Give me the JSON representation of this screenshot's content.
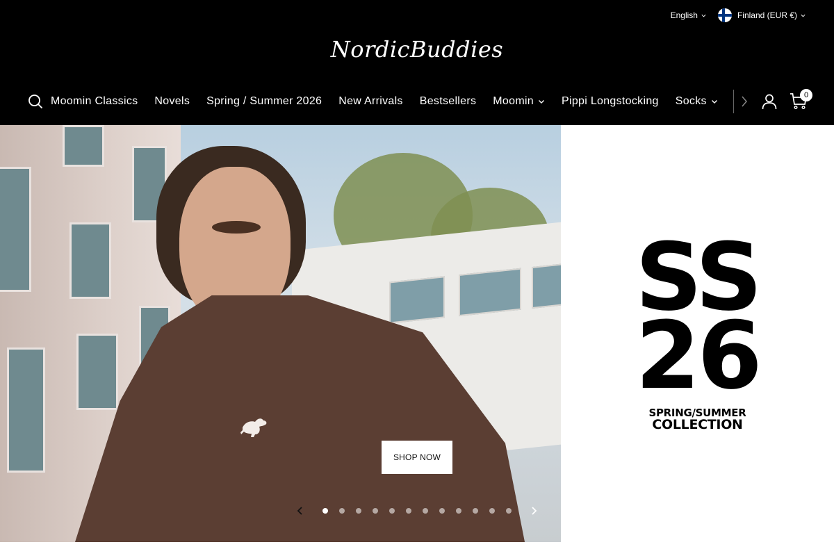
{
  "header": {
    "locale": {
      "language": "English",
      "country": "Finland (EUR €)"
    },
    "logo": "NordicBuddies",
    "nav": [
      {
        "label": "Moomin Classics",
        "dropdown": false
      },
      {
        "label": "Novels",
        "dropdown": false
      },
      {
        "label": "Spring / Summer 2026",
        "dropdown": false
      },
      {
        "label": "New Arrivals",
        "dropdown": false
      },
      {
        "label": "Bestsellers",
        "dropdown": false
      },
      {
        "label": "Moomin",
        "dropdown": true
      },
      {
        "label": "Pippi Longstocking",
        "dropdown": false
      },
      {
        "label": "Socks",
        "dropdown": true
      }
    ],
    "cart_count": "0"
  },
  "hero": {
    "cta": "SHOP NOW",
    "side": {
      "line1": "SS",
      "line2": "26",
      "sub1": "SPRING/SUMMER",
      "sub2": "COLLECTION"
    },
    "slides_total": 12,
    "active_slide": 1
  },
  "colors": {
    "header_bg": "#000000",
    "shirt": "#5b3e33",
    "button_bg": "#ffffff"
  },
  "icons": [
    "search-icon",
    "chevron-down-icon",
    "chevron-right-icon",
    "account-icon",
    "cart-icon",
    "finland-flag-icon",
    "chevron-left-icon"
  ]
}
